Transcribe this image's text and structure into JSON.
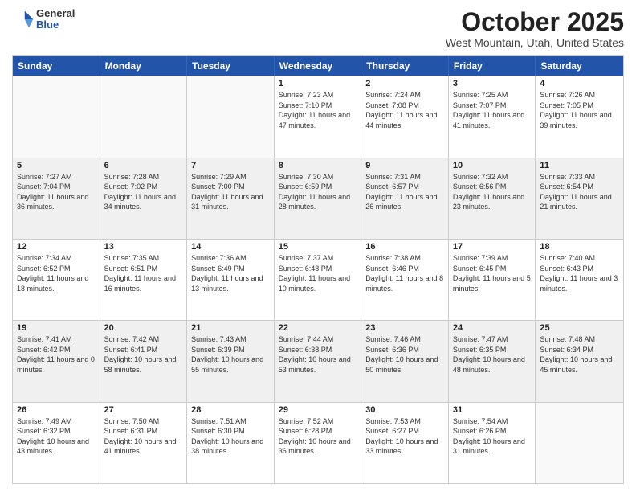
{
  "header": {
    "logo": {
      "general": "General",
      "blue": "Blue"
    },
    "title": "October 2025",
    "location": "West Mountain, Utah, United States"
  },
  "days_of_week": [
    "Sunday",
    "Monday",
    "Tuesday",
    "Wednesday",
    "Thursday",
    "Friday",
    "Saturday"
  ],
  "weeks": [
    [
      {
        "day": "",
        "info": ""
      },
      {
        "day": "",
        "info": ""
      },
      {
        "day": "",
        "info": ""
      },
      {
        "day": "1",
        "info": "Sunrise: 7:23 AM\nSunset: 7:10 PM\nDaylight: 11 hours and 47 minutes."
      },
      {
        "day": "2",
        "info": "Sunrise: 7:24 AM\nSunset: 7:08 PM\nDaylight: 11 hours and 44 minutes."
      },
      {
        "day": "3",
        "info": "Sunrise: 7:25 AM\nSunset: 7:07 PM\nDaylight: 11 hours and 41 minutes."
      },
      {
        "day": "4",
        "info": "Sunrise: 7:26 AM\nSunset: 7:05 PM\nDaylight: 11 hours and 39 minutes."
      }
    ],
    [
      {
        "day": "5",
        "info": "Sunrise: 7:27 AM\nSunset: 7:04 PM\nDaylight: 11 hours and 36 minutes."
      },
      {
        "day": "6",
        "info": "Sunrise: 7:28 AM\nSunset: 7:02 PM\nDaylight: 11 hours and 34 minutes."
      },
      {
        "day": "7",
        "info": "Sunrise: 7:29 AM\nSunset: 7:00 PM\nDaylight: 11 hours and 31 minutes."
      },
      {
        "day": "8",
        "info": "Sunrise: 7:30 AM\nSunset: 6:59 PM\nDaylight: 11 hours and 28 minutes."
      },
      {
        "day": "9",
        "info": "Sunrise: 7:31 AM\nSunset: 6:57 PM\nDaylight: 11 hours and 26 minutes."
      },
      {
        "day": "10",
        "info": "Sunrise: 7:32 AM\nSunset: 6:56 PM\nDaylight: 11 hours and 23 minutes."
      },
      {
        "day": "11",
        "info": "Sunrise: 7:33 AM\nSunset: 6:54 PM\nDaylight: 11 hours and 21 minutes."
      }
    ],
    [
      {
        "day": "12",
        "info": "Sunrise: 7:34 AM\nSunset: 6:52 PM\nDaylight: 11 hours and 18 minutes."
      },
      {
        "day": "13",
        "info": "Sunrise: 7:35 AM\nSunset: 6:51 PM\nDaylight: 11 hours and 16 minutes."
      },
      {
        "day": "14",
        "info": "Sunrise: 7:36 AM\nSunset: 6:49 PM\nDaylight: 11 hours and 13 minutes."
      },
      {
        "day": "15",
        "info": "Sunrise: 7:37 AM\nSunset: 6:48 PM\nDaylight: 11 hours and 10 minutes."
      },
      {
        "day": "16",
        "info": "Sunrise: 7:38 AM\nSunset: 6:46 PM\nDaylight: 11 hours and 8 minutes."
      },
      {
        "day": "17",
        "info": "Sunrise: 7:39 AM\nSunset: 6:45 PM\nDaylight: 11 hours and 5 minutes."
      },
      {
        "day": "18",
        "info": "Sunrise: 7:40 AM\nSunset: 6:43 PM\nDaylight: 11 hours and 3 minutes."
      }
    ],
    [
      {
        "day": "19",
        "info": "Sunrise: 7:41 AM\nSunset: 6:42 PM\nDaylight: 11 hours and 0 minutes."
      },
      {
        "day": "20",
        "info": "Sunrise: 7:42 AM\nSunset: 6:41 PM\nDaylight: 10 hours and 58 minutes."
      },
      {
        "day": "21",
        "info": "Sunrise: 7:43 AM\nSunset: 6:39 PM\nDaylight: 10 hours and 55 minutes."
      },
      {
        "day": "22",
        "info": "Sunrise: 7:44 AM\nSunset: 6:38 PM\nDaylight: 10 hours and 53 minutes."
      },
      {
        "day": "23",
        "info": "Sunrise: 7:46 AM\nSunset: 6:36 PM\nDaylight: 10 hours and 50 minutes."
      },
      {
        "day": "24",
        "info": "Sunrise: 7:47 AM\nSunset: 6:35 PM\nDaylight: 10 hours and 48 minutes."
      },
      {
        "day": "25",
        "info": "Sunrise: 7:48 AM\nSunset: 6:34 PM\nDaylight: 10 hours and 45 minutes."
      }
    ],
    [
      {
        "day": "26",
        "info": "Sunrise: 7:49 AM\nSunset: 6:32 PM\nDaylight: 10 hours and 43 minutes."
      },
      {
        "day": "27",
        "info": "Sunrise: 7:50 AM\nSunset: 6:31 PM\nDaylight: 10 hours and 41 minutes."
      },
      {
        "day": "28",
        "info": "Sunrise: 7:51 AM\nSunset: 6:30 PM\nDaylight: 10 hours and 38 minutes."
      },
      {
        "day": "29",
        "info": "Sunrise: 7:52 AM\nSunset: 6:28 PM\nDaylight: 10 hours and 36 minutes."
      },
      {
        "day": "30",
        "info": "Sunrise: 7:53 AM\nSunset: 6:27 PM\nDaylight: 10 hours and 33 minutes."
      },
      {
        "day": "31",
        "info": "Sunrise: 7:54 AM\nSunset: 6:26 PM\nDaylight: 10 hours and 31 minutes."
      },
      {
        "day": "",
        "info": ""
      }
    ]
  ]
}
